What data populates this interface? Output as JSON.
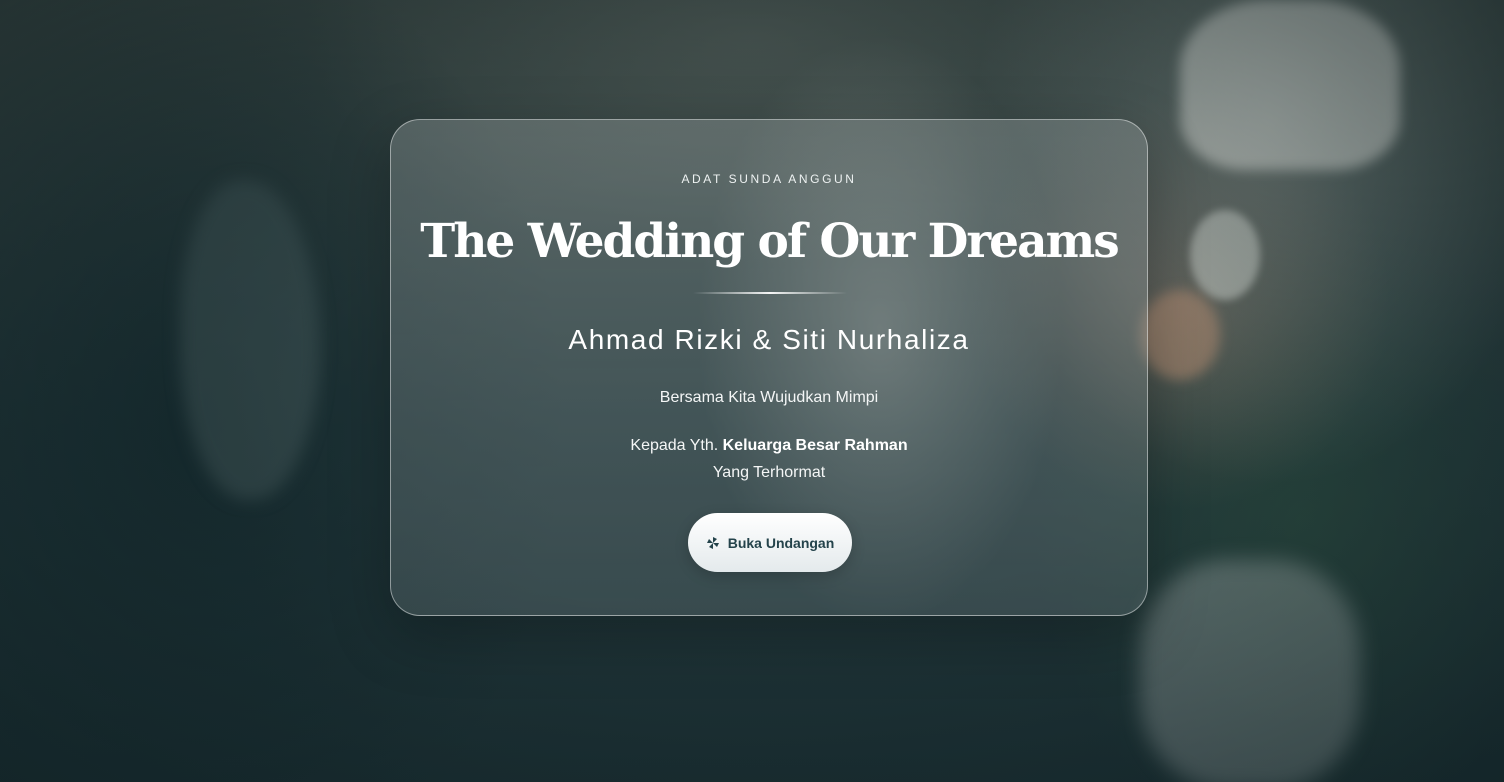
{
  "card": {
    "eyebrow": "ADAT SUNDA ANGGUN",
    "title": "The Wedding of Our Dreams",
    "couple": "Ahmad Rizki & Siti Nurhaliza",
    "tagline": "Bersama Kita Wujudkan Mimpi",
    "recipient_prefix": "Kepada Yth. ",
    "recipient_name": "Keluarga Besar Rahman",
    "recipient_suffix": "Yang Terhormat",
    "open_button_label": "Buka Undangan",
    "open_button_icon": "pinwheel-icon"
  },
  "colors": {
    "accent_text": "#24434b",
    "card_border": "rgba(255,255,255,0.45)",
    "background": "#1f3236"
  }
}
